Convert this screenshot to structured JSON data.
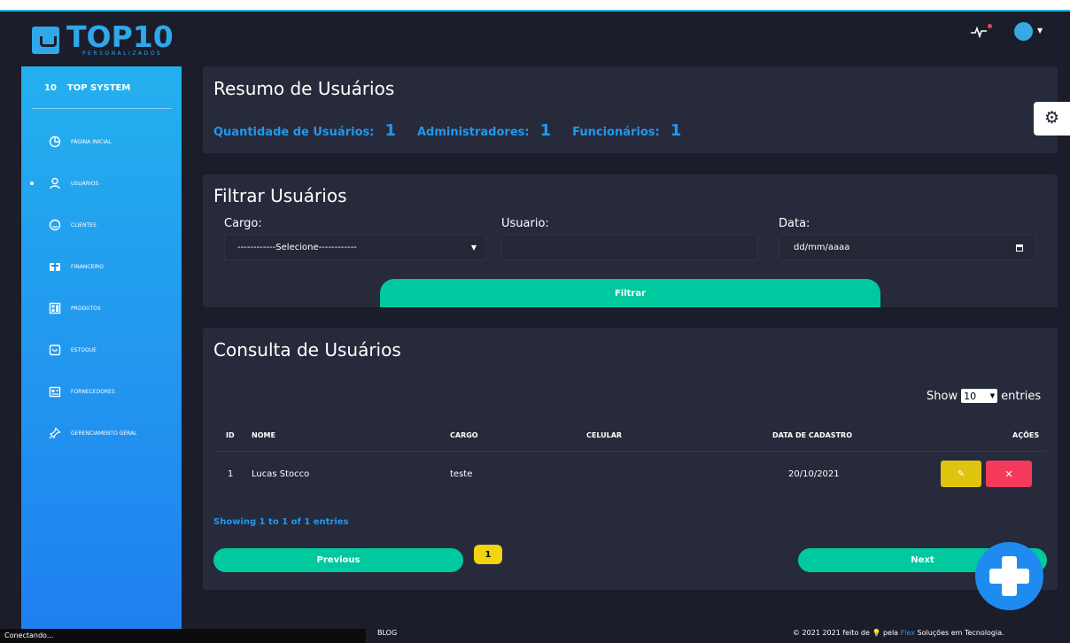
{
  "brand": {
    "logo_main": "TOP10",
    "logo_sub": "PERSONALIZADOS"
  },
  "sidebar": {
    "brand_short": "10",
    "brand_name": "TOP SYSTEM",
    "items": [
      {
        "label": "PÁGINA INICIAL",
        "icon": "pie-chart-icon"
      },
      {
        "label": "USUÁRIOS",
        "icon": "user-icon",
        "active": true
      },
      {
        "label": "CLIENTES",
        "icon": "smile-icon"
      },
      {
        "label": "FINANCEIRO",
        "icon": "finance-icon"
      },
      {
        "label": "PRODUTOS",
        "icon": "products-icon"
      },
      {
        "label": "ESTOQUE",
        "icon": "stock-icon"
      },
      {
        "label": "FORNECEDORES",
        "icon": "suppliers-icon"
      },
      {
        "label": "GERENCIAMENTO GERAL",
        "icon": "pin-icon"
      }
    ]
  },
  "summary": {
    "title": "Resumo de Usuários",
    "stats": [
      {
        "label": "Quantidade de Usuários:",
        "value": "1"
      },
      {
        "label": "Administradores:",
        "value": "1"
      },
      {
        "label": "Funcionários:",
        "value": "1"
      }
    ]
  },
  "filter": {
    "title": "Filtrar Usuários",
    "cargo_label": "Cargo:",
    "cargo_selected": "------------Selecione------------",
    "usuario_label": "Usuario:",
    "usuario_value": "",
    "data_label": "Data:",
    "data_placeholder": "dd/mm/aaaa",
    "button_label": "Filtrar"
  },
  "consulta": {
    "title": "Consulta de Usuários",
    "show_label": "Show",
    "show_value": "10",
    "entries_label": "entries",
    "columns": [
      "ID",
      "NOME",
      "CARGO",
      "CELULAR",
      "DATA DE CADASTRO",
      "AÇÕES"
    ],
    "rows": [
      {
        "id": "1",
        "nome": "Lucas Stocco",
        "cargo": "teste",
        "celular": "",
        "data": "20/10/2021"
      }
    ],
    "showing": "Showing 1 to 1 of 1 entries",
    "previous": "Previous",
    "page": "1",
    "next": "Next"
  },
  "statusbar": {
    "text": "Conectando..."
  },
  "footer": {
    "blog": "BLOG",
    "copy_prefix": "© 2021 2021 feito de ",
    "copy_mid": " pela ",
    "copy_link": "Flex",
    "copy_suffix": " Soluções em Tecnologia."
  },
  "colors": {
    "background": "#1b1d2a",
    "card": "#272a3b",
    "accent_blue": "#1f98f0",
    "accent_green": "#00c9a0",
    "edit_yellow": "#dfc40f",
    "delete_red": "#f33a5a"
  }
}
